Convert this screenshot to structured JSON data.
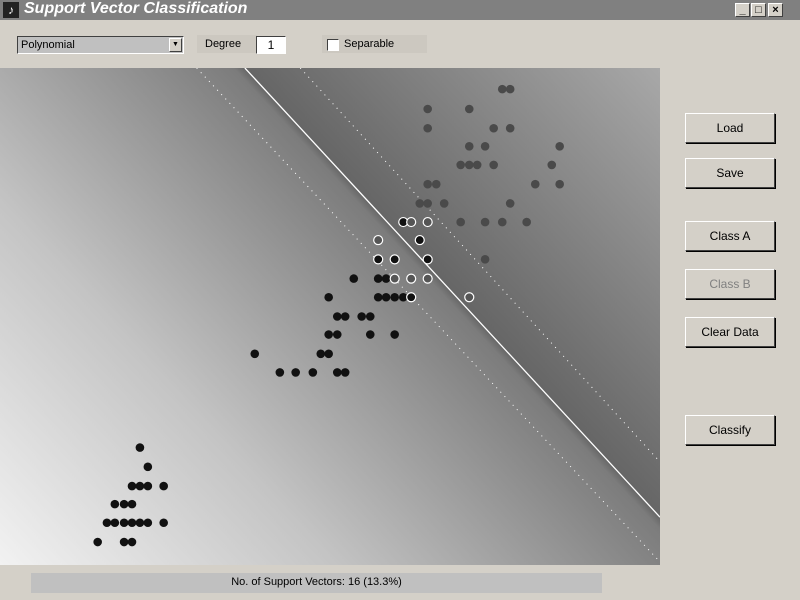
{
  "window": {
    "title": "Support Vector Classification",
    "icon": "matlab-icon",
    "controls": [
      "_",
      "□",
      "×"
    ]
  },
  "toolbar": {
    "kernel": "Polynomial",
    "degree_label": "Degree",
    "degree_value": "1",
    "separable_label": "Separable",
    "separable_checked": false
  },
  "buttons": [
    {
      "label": "Load",
      "enabled": true
    },
    {
      "label": "Save",
      "enabled": true
    },
    {
      "label": "Class A",
      "enabled": true
    },
    {
      "label": "Class B",
      "enabled": false
    },
    {
      "label": "Clear Data",
      "enabled": true
    },
    {
      "label": "Classify",
      "enabled": true
    }
  ],
  "status": "No. of Support Vectors: 16 (13.3%)",
  "colors": {
    "class_a": "#4a4a4a",
    "class_b": "#111111",
    "boundary": "#ffffff"
  },
  "chart_data": {
    "type": "scatter",
    "xlim": [
      0,
      10
    ],
    "ylim": [
      0,
      8
    ],
    "grid": false,
    "decision_boundary": {
      "from": [
        3.71,
        8
      ],
      "to": [
        10,
        0.77
      ]
    },
    "margins": [
      {
        "from": [
          2.98,
          8
        ],
        "to": [
          10,
          0.05
        ]
      },
      {
        "from": [
          4.55,
          8
        ],
        "to": [
          10,
          1.66
        ]
      }
    ],
    "series": [
      {
        "class": "A",
        "points": [
          [
            7.61,
            7.66
          ],
          [
            7.73,
            7.66
          ],
          [
            6.48,
            7.34
          ],
          [
            7.11,
            7.34
          ],
          [
            6.48,
            7.03
          ],
          [
            7.48,
            7.03
          ],
          [
            7.73,
            7.03
          ],
          [
            7.11,
            6.74
          ],
          [
            7.35,
            6.74
          ],
          [
            8.48,
            6.74
          ],
          [
            6.98,
            6.44
          ],
          [
            7.11,
            6.44
          ],
          [
            7.23,
            6.44
          ],
          [
            7.48,
            6.44
          ],
          [
            8.36,
            6.44
          ],
          [
            6.48,
            6.13
          ],
          [
            6.61,
            6.13
          ],
          [
            8.11,
            6.13
          ],
          [
            8.48,
            6.13
          ],
          [
            6.36,
            5.82
          ],
          [
            6.48,
            5.82
          ],
          [
            6.73,
            5.82
          ],
          [
            7.73,
            5.82
          ],
          [
            6.98,
            5.52
          ],
          [
            7.35,
            5.52
          ],
          [
            7.61,
            5.52
          ],
          [
            7.98,
            5.52
          ],
          [
            7.35,
            4.92
          ]
        ]
      },
      {
        "class": "B",
        "points": [
          [
            5.36,
            4.61
          ],
          [
            5.73,
            4.61
          ],
          [
            5.85,
            4.61
          ],
          [
            5.73,
            4.31
          ],
          [
            5.85,
            4.31
          ],
          [
            5.98,
            4.31
          ],
          [
            6.11,
            4.31
          ],
          [
            4.98,
            4.31
          ],
          [
            5.23,
            4.0
          ],
          [
            5.11,
            4.0
          ],
          [
            5.48,
            4.0
          ],
          [
            5.61,
            4.0
          ],
          [
            4.98,
            3.71
          ],
          [
            5.11,
            3.71
          ],
          [
            5.61,
            3.71
          ],
          [
            5.98,
            3.71
          ],
          [
            4.86,
            3.4
          ],
          [
            4.98,
            3.4
          ],
          [
            3.86,
            3.4
          ],
          [
            4.24,
            3.1
          ],
          [
            4.48,
            3.1
          ],
          [
            4.74,
            3.1
          ],
          [
            5.11,
            3.1
          ],
          [
            5.23,
            3.1
          ],
          [
            2.12,
            1.89
          ],
          [
            2.24,
            1.58
          ],
          [
            2.0,
            1.27
          ],
          [
            2.12,
            1.27
          ],
          [
            2.24,
            1.27
          ],
          [
            2.48,
            1.27
          ],
          [
            1.74,
            0.98
          ],
          [
            1.88,
            0.98
          ],
          [
            2.0,
            0.98
          ],
          [
            1.62,
            0.68
          ],
          [
            1.74,
            0.68
          ],
          [
            1.88,
            0.68
          ],
          [
            2.0,
            0.68
          ],
          [
            2.12,
            0.68
          ],
          [
            2.24,
            0.68
          ],
          [
            2.48,
            0.68
          ],
          [
            1.48,
            0.37
          ],
          [
            1.88,
            0.37
          ],
          [
            2.0,
            0.37
          ]
        ]
      }
    ],
    "support_vectors": [
      {
        "p": [
          6.11,
          5.52
        ],
        "class": "B"
      },
      {
        "p": [
          6.23,
          5.52
        ],
        "class": "A"
      },
      {
        "p": [
          6.48,
          5.52
        ],
        "class": "A"
      },
      {
        "p": [
          5.73,
          5.23
        ],
        "class": "A"
      },
      {
        "p": [
          6.36,
          5.23
        ],
        "class": "B"
      },
      {
        "p": [
          5.73,
          4.92
        ],
        "class": "B"
      },
      {
        "p": [
          5.98,
          4.92
        ],
        "class": "B"
      },
      {
        "p": [
          6.48,
          4.92
        ],
        "class": "B"
      },
      {
        "p": [
          5.98,
          4.61
        ],
        "class": "A"
      },
      {
        "p": [
          6.23,
          4.61
        ],
        "class": "A"
      },
      {
        "p": [
          6.48,
          4.61
        ],
        "class": "A"
      },
      {
        "p": [
          6.23,
          4.31
        ],
        "class": "B"
      },
      {
        "p": [
          7.11,
          4.31
        ],
        "class": "A"
      }
    ]
  }
}
